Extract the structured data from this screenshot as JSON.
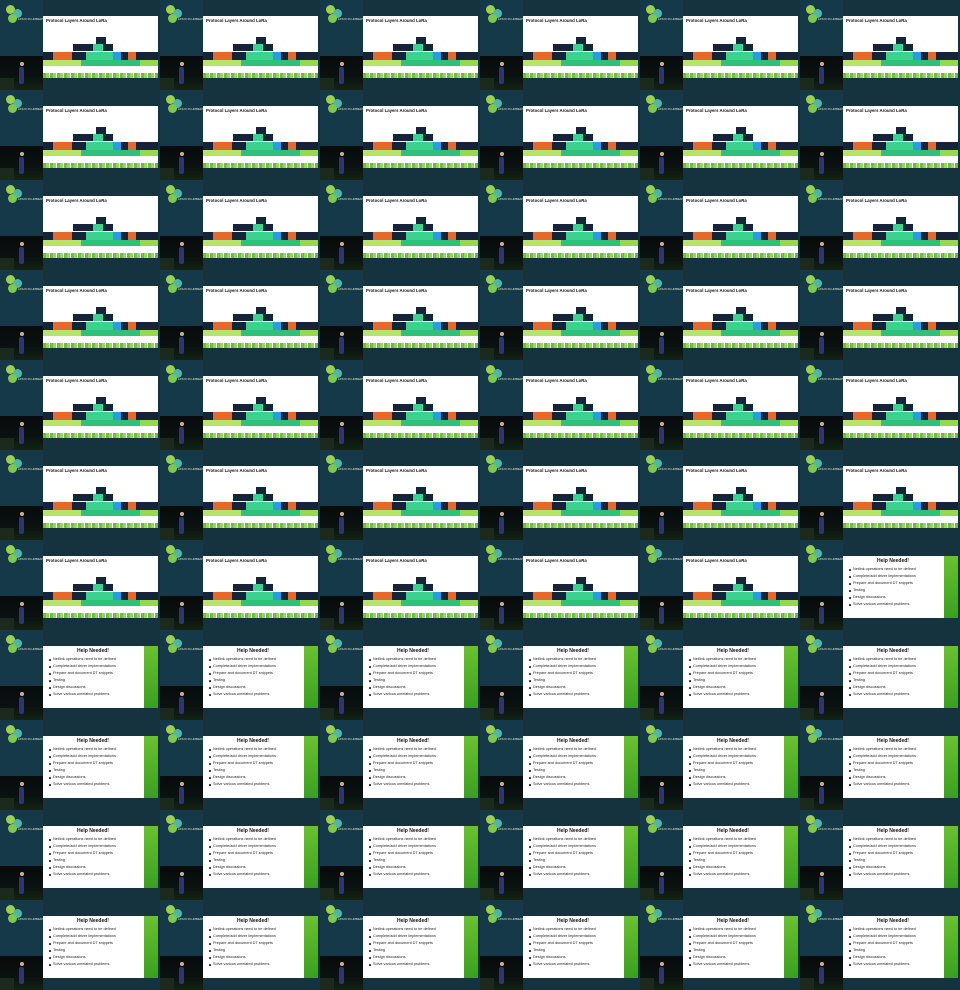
{
  "logo_text": "LINUX PLUMBERS",
  "slides": {
    "protocol": {
      "title": "Protocol Layers Around LoRa"
    },
    "help": {
      "title": "Help Needed!",
      "items": [
        "Netlink operations need to be defined",
        "Complete/add driver implementations",
        "Prepare and document DT snippets",
        "Testing",
        "Design discussions",
        "Solve various unrelated problems"
      ]
    }
  },
  "grid": {
    "columns": 6,
    "rows": 11,
    "protocol_count": 41
  },
  "colors": {
    "background": "#17394a",
    "navy": "#15243a",
    "orange": "#e4692b",
    "teal": "#3cd18d",
    "blue": "#2c9ae6",
    "lime": "#b8e36a",
    "green_accent": "#69c12f"
  }
}
